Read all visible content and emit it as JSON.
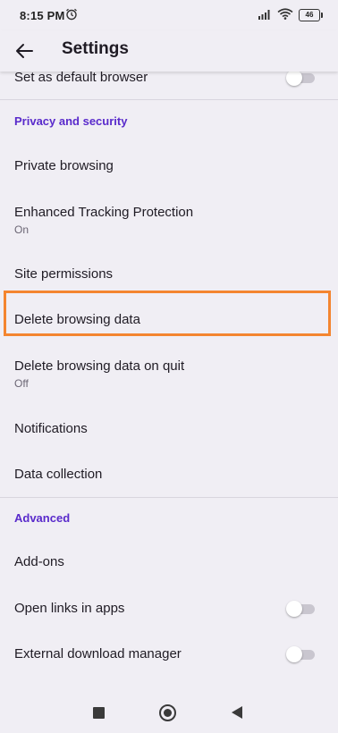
{
  "status_bar": {
    "time": "8:15 PM",
    "battery": "46"
  },
  "app_bar": {
    "title": "Settings"
  },
  "rows": {
    "default_browser": "Set as default browser",
    "privacy_header": "Privacy and security",
    "private_browsing": "Private browsing",
    "etp": "Enhanced Tracking Protection",
    "etp_sub": "On",
    "site_permissions": "Site permissions",
    "delete_data": "Delete browsing data",
    "delete_on_quit": "Delete browsing data on quit",
    "delete_on_quit_sub": "Off",
    "notifications": "Notifications",
    "data_collection": "Data collection",
    "advanced_header": "Advanced",
    "addons": "Add-ons",
    "open_links": "Open links in apps",
    "download_manager": "External download manager"
  },
  "colors": {
    "section_header": "#592acb",
    "highlight": "#f4852f",
    "background": "#f0eef4"
  }
}
